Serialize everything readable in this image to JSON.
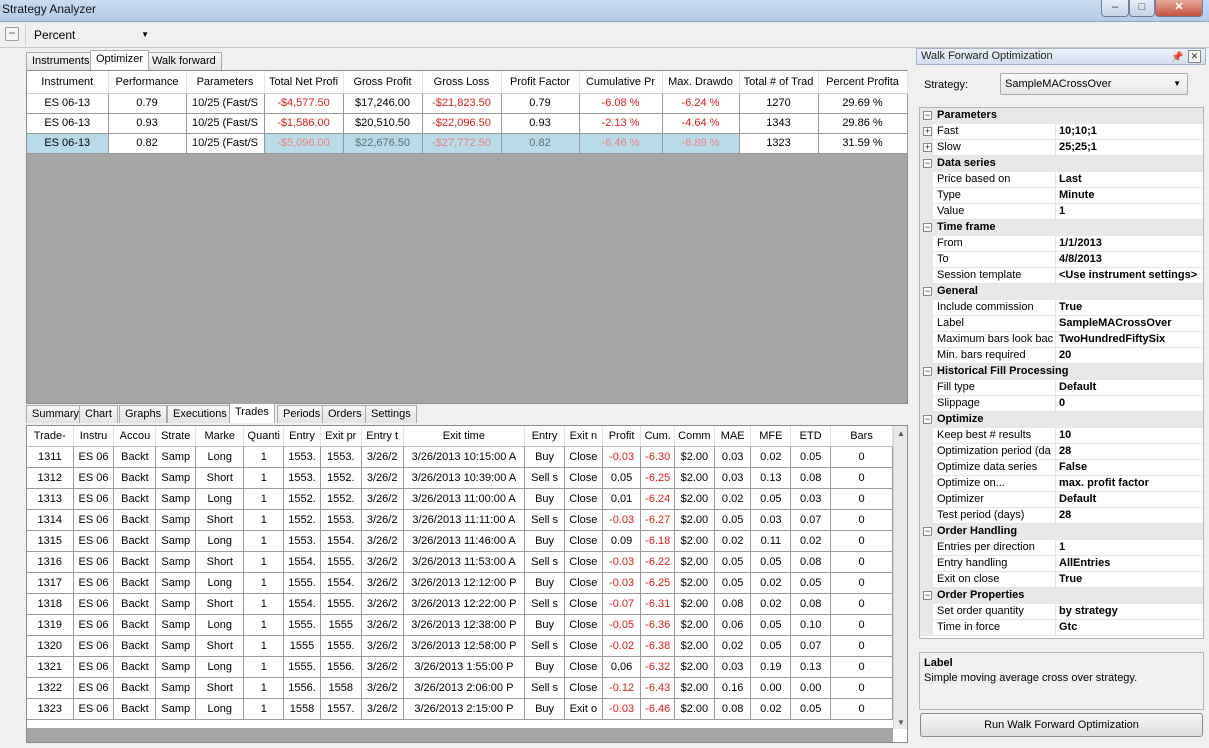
{
  "window": {
    "title": "Strategy Analyzer",
    "controls": {
      "minimize": "–",
      "maximize": "□",
      "close": "✕"
    }
  },
  "toolbar": {
    "display_mode": "Percent"
  },
  "top_tabs": [
    "Instruments",
    "Optimizer",
    "Walk forward"
  ],
  "optimizer": {
    "columns": [
      "Instrument",
      "Performance",
      "Parameters",
      "Total Net Profi",
      "Gross Profit",
      "Gross Loss",
      "Profit Factor",
      "Cumulative Pr",
      "Max. Drawdo",
      "Total # of Trad",
      "Percent Profita"
    ],
    "rows": [
      [
        "ES 06-13",
        "0.79",
        "10/25 (Fast/S",
        "-$4,577.50",
        "$17,246.00",
        "-$21,823.50",
        "0.79",
        "-6.08 %",
        "-6.24 %",
        "1270",
        "29.69 %"
      ],
      [
        "ES 06-13",
        "0.93",
        "10/25 (Fast/S",
        "-$1,586.00",
        "$20,510.50",
        "-$22,096.50",
        "0.93",
        "-2.13 %",
        "-4.64 %",
        "1343",
        "29.86 %"
      ],
      [
        "ES 06-13",
        "0.82",
        "10/25 (Fast/S",
        "-$5,096.00",
        "$22,676.50",
        "-$27,772.50",
        "0.82",
        "-6.46 %",
        "-6.89 %",
        "1323",
        "31.59 %"
      ]
    ],
    "selected_row": 2
  },
  "bottom_tabs": [
    "Summary",
    "Chart",
    "Graphs",
    "Executions",
    "Trades",
    "Periods",
    "Orders",
    "Settings"
  ],
  "trades": {
    "columns": [
      "Trade-",
      "Instru",
      "Accou",
      "Strate",
      "Marke",
      "Quanti",
      "Entry",
      "Exit pr",
      "Entry t",
      "Exit time",
      "Entry",
      "Exit n",
      "Profit",
      "Cum.",
      "Comm",
      "MAE",
      "MFE",
      "ETD",
      "Bars"
    ],
    "rows": [
      [
        "1311",
        "ES 06",
        "Backt",
        "Samp",
        "Long",
        "1",
        "1553.",
        "1553.",
        "3/26/2",
        "3/26/2013 10:15:00 A",
        "Buy",
        "Close",
        "-0.03",
        "-6.30",
        "$2.00",
        "0.03",
        "0.02",
        "0.05",
        "0"
      ],
      [
        "1312",
        "ES 06",
        "Backt",
        "Samp",
        "Short",
        "1",
        "1553.",
        "1552.",
        "3/26/2",
        "3/26/2013 10:39:00 A",
        "Sell s",
        "Close",
        "0.05",
        "-6.25",
        "$2.00",
        "0.03",
        "0.13",
        "0.08",
        "0"
      ],
      [
        "1313",
        "ES 06",
        "Backt",
        "Samp",
        "Long",
        "1",
        "1552.",
        "1552.",
        "3/26/2",
        "3/26/2013 11:00:00 A",
        "Buy",
        "Close",
        "0.01",
        "-6.24",
        "$2.00",
        "0.02",
        "0.05",
        "0.03",
        "0"
      ],
      [
        "1314",
        "ES 06",
        "Backt",
        "Samp",
        "Short",
        "1",
        "1552.",
        "1553.",
        "3/26/2",
        "3/26/2013 11:11:00 A",
        "Sell s",
        "Close",
        "-0.03",
        "-6.27",
        "$2.00",
        "0.05",
        "0.03",
        "0.07",
        "0"
      ],
      [
        "1315",
        "ES 06",
        "Backt",
        "Samp",
        "Long",
        "1",
        "1553.",
        "1554.",
        "3/26/2",
        "3/26/2013 11:46:00 A",
        "Buy",
        "Close",
        "0.09",
        "-6.18",
        "$2.00",
        "0.02",
        "0.11",
        "0.02",
        "0"
      ],
      [
        "1316",
        "ES 06",
        "Backt",
        "Samp",
        "Short",
        "1",
        "1554.",
        "1555.",
        "3/26/2",
        "3/26/2013 11:53:00 A",
        "Sell s",
        "Close",
        "-0.03",
        "-6.22",
        "$2.00",
        "0.05",
        "0.05",
        "0.08",
        "0"
      ],
      [
        "1317",
        "ES 06",
        "Backt",
        "Samp",
        "Long",
        "1",
        "1555.",
        "1554.",
        "3/26/2",
        "3/26/2013 12:12:00 P",
        "Buy",
        "Close",
        "-0.03",
        "-6.25",
        "$2.00",
        "0.05",
        "0.02",
        "0.05",
        "0"
      ],
      [
        "1318",
        "ES 06",
        "Backt",
        "Samp",
        "Short",
        "1",
        "1554.",
        "1555.",
        "3/26/2",
        "3/26/2013 12:22:00 P",
        "Sell s",
        "Close",
        "-0.07",
        "-6.31",
        "$2.00",
        "0.08",
        "0.02",
        "0.08",
        "0"
      ],
      [
        "1319",
        "ES 06",
        "Backt",
        "Samp",
        "Long",
        "1",
        "1555.",
        "1555",
        "3/26/2",
        "3/26/2013 12:38:00 P",
        "Buy",
        "Close",
        "-0.05",
        "-6.36",
        "$2.00",
        "0.06",
        "0.05",
        "0.10",
        "0"
      ],
      [
        "1320",
        "ES 06",
        "Backt",
        "Samp",
        "Short",
        "1",
        "1555",
        "1555.",
        "3/26/2",
        "3/26/2013 12:58:00 P",
        "Sell s",
        "Close",
        "-0.02",
        "-6.38",
        "$2.00",
        "0.02",
        "0.05",
        "0.07",
        "0"
      ],
      [
        "1321",
        "ES 06",
        "Backt",
        "Samp",
        "Long",
        "1",
        "1555.",
        "1556.",
        "3/26/2",
        "3/26/2013 1:55:00 P",
        "Buy",
        "Close",
        "0.06",
        "-6.32",
        "$2.00",
        "0.03",
        "0.19",
        "0.13",
        "0"
      ],
      [
        "1322",
        "ES 06",
        "Backt",
        "Samp",
        "Short",
        "1",
        "1556.",
        "1558",
        "3/26/2",
        "3/26/2013 2:06:00 P",
        "Sell s",
        "Close",
        "-0.12",
        "-6.43",
        "$2.00",
        "0.16",
        "0.00",
        "0.00",
        "0"
      ],
      [
        "1323",
        "ES 06",
        "Backt",
        "Samp",
        "Long",
        "1",
        "1558",
        "1557.",
        "3/26/2",
        "3/26/2013 2:15:00 P",
        "Buy",
        "Exit o",
        "-0.03",
        "-6.46",
        "$2.00",
        "0.08",
        "0.02",
        "0.05",
        "0"
      ]
    ]
  },
  "wfo": {
    "header": "Walk Forward Optimization",
    "strategy_label": "Strategy:",
    "strategy_value": "SampleMACrossOver",
    "sections": [
      {
        "title": "Parameters",
        "rows": [
          {
            "name": "Fast",
            "value": "10;10;1",
            "expand": true
          },
          {
            "name": "Slow",
            "value": "25;25;1",
            "expand": true
          }
        ]
      },
      {
        "title": "Data series",
        "rows": [
          {
            "name": "Price based on",
            "value": "Last"
          },
          {
            "name": "Type",
            "value": "Minute"
          },
          {
            "name": "Value",
            "value": "1"
          }
        ]
      },
      {
        "title": "Time frame",
        "rows": [
          {
            "name": "From",
            "value": "1/1/2013"
          },
          {
            "name": "To",
            "value": "4/8/2013"
          },
          {
            "name": "Session template",
            "value": "<Use instrument settings>"
          }
        ]
      },
      {
        "title": "General",
        "rows": [
          {
            "name": "Include commission",
            "value": "True"
          },
          {
            "name": "Label",
            "value": "SampleMACrossOver"
          },
          {
            "name": "Maximum bars look bac",
            "value": "TwoHundredFiftySix"
          },
          {
            "name": "Min. bars required",
            "value": "20"
          }
        ]
      },
      {
        "title": "Historical Fill Processing",
        "rows": [
          {
            "name": "Fill type",
            "value": "Default"
          },
          {
            "name": "Slippage",
            "value": "0"
          }
        ]
      },
      {
        "title": "Optimize",
        "rows": [
          {
            "name": "Keep best # results",
            "value": "10"
          },
          {
            "name": "Optimization period (da",
            "value": "28"
          },
          {
            "name": "Optimize data series",
            "value": "False"
          },
          {
            "name": "Optimize on...",
            "value": "max. profit factor"
          },
          {
            "name": "Optimizer",
            "value": "Default"
          },
          {
            "name": "Test period (days)",
            "value": "28"
          }
        ]
      },
      {
        "title": "Order Handling",
        "rows": [
          {
            "name": "Entries per direction",
            "value": "1"
          },
          {
            "name": "Entry handling",
            "value": "AllEntries"
          },
          {
            "name": "Exit on close",
            "value": "True"
          }
        ]
      },
      {
        "title": "Order Properties",
        "rows": [
          {
            "name": "Set order quantity",
            "value": "by strategy"
          },
          {
            "name": "Time in force",
            "value": "Gtc"
          }
        ]
      }
    ],
    "description_title": "Label",
    "description_text": "Simple moving average cross over strategy.",
    "run_button": "Run Walk Forward Optimization"
  },
  "colors": {
    "negative": "#e01a1a",
    "selected_row": "#b7dbe8",
    "empty_area": "#a5a5a5"
  }
}
